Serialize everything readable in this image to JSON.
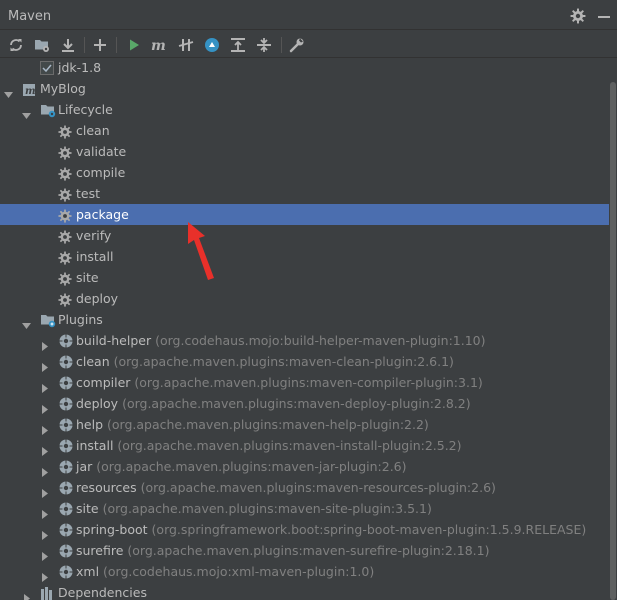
{
  "window": {
    "title": "Maven"
  },
  "toolbar": {
    "buttons": [
      {
        "name": "reimport-icon"
      },
      {
        "name": "generate-sources-icon"
      },
      {
        "name": "download-icon"
      },
      {
        "name": "add-icon"
      },
      {
        "name": "run-icon"
      },
      {
        "name": "execute-goal-icon"
      },
      {
        "name": "skip-tests-icon"
      },
      {
        "name": "show-dependencies-icon"
      },
      {
        "name": "expand-all-icon"
      },
      {
        "name": "collapse-all-icon"
      },
      {
        "name": "settings-wrench-icon"
      }
    ]
  },
  "tree": {
    "jdk": {
      "label": "jdk-1.8"
    },
    "project": {
      "label": "MyBlog"
    },
    "lifecycle": {
      "label": "Lifecycle",
      "goals": [
        "clean",
        "validate",
        "compile",
        "test",
        "package",
        "verify",
        "install",
        "site",
        "deploy"
      ],
      "selected": "package"
    },
    "plugins": {
      "label": "Plugins",
      "items": [
        {
          "name": "build-helper",
          "coord": "(org.codehaus.mojo:build-helper-maven-plugin:1.10)"
        },
        {
          "name": "clean",
          "coord": "(org.apache.maven.plugins:maven-clean-plugin:2.6.1)"
        },
        {
          "name": "compiler",
          "coord": "(org.apache.maven.plugins:maven-compiler-plugin:3.1)"
        },
        {
          "name": "deploy",
          "coord": "(org.apache.maven.plugins:maven-deploy-plugin:2.8.2)"
        },
        {
          "name": "help",
          "coord": "(org.apache.maven.plugins:maven-help-plugin:2.2)"
        },
        {
          "name": "install",
          "coord": "(org.apache.maven.plugins:maven-install-plugin:2.5.2)"
        },
        {
          "name": "jar",
          "coord": "(org.apache.maven.plugins:maven-jar-plugin:2.6)"
        },
        {
          "name": "resources",
          "coord": "(org.apache.maven.plugins:maven-resources-plugin:2.6)"
        },
        {
          "name": "site",
          "coord": "(org.apache.maven.plugins:maven-site-plugin:3.5.1)"
        },
        {
          "name": "spring-boot",
          "coord": "(org.springframework.boot:spring-boot-maven-plugin:1.5.9.RELEASE)"
        },
        {
          "name": "surefire",
          "coord": "(org.apache.maven.plugins:maven-surefire-plugin:2.18.1)"
        },
        {
          "name": "xml",
          "coord": "(org.codehaus.mojo:xml-maven-plugin:1.0)"
        }
      ]
    },
    "dependencies": {
      "label": "Dependencies"
    }
  },
  "colors": {
    "background": "#3c3f41",
    "selection": "#4b6eaf",
    "run_green": "#59a869",
    "annotation_arrow": "#e8302a"
  }
}
